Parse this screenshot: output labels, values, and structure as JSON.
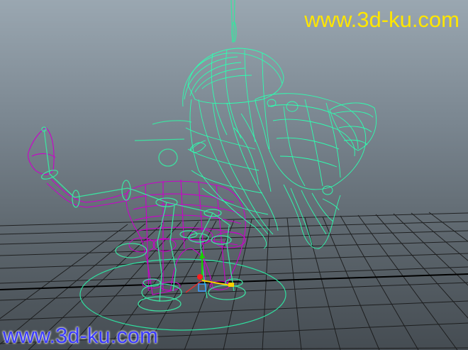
{
  "viewport": {
    "background_top": "#9aa7b1",
    "background_bottom": "#454c52",
    "grid_color": "#1a1a1a",
    "mesh_color_head": "#2dffb0",
    "mesh_color_body": "#cc00cc",
    "rig_color": "#33e0a0"
  },
  "watermark_top": {
    "text": "www.3d-ku.com",
    "color": "#ffe600"
  },
  "watermark_bottom": {
    "text": "www.3d-ku.com",
    "color": "#3b3bff"
  },
  "icons": {
    "manipulator": "move-manipulator-icon"
  }
}
